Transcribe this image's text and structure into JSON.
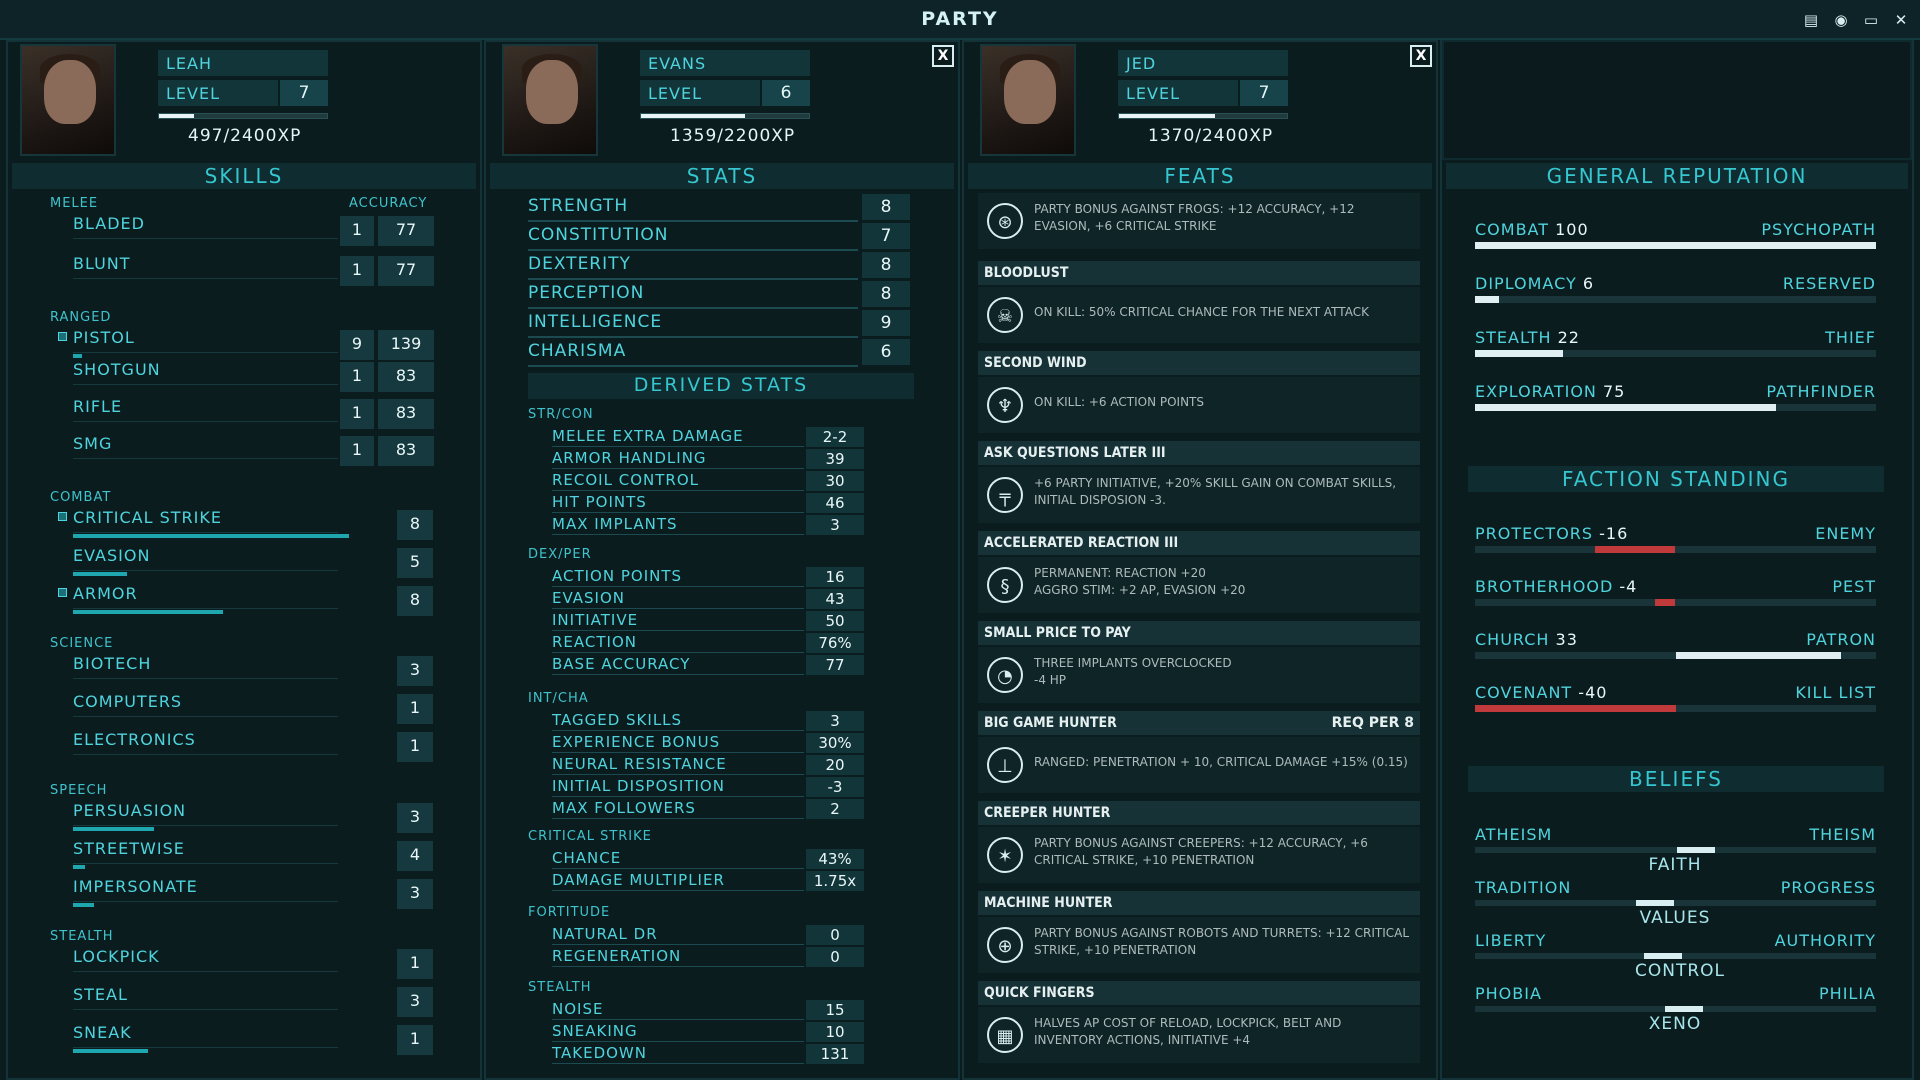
{
  "title": "PARTY",
  "window_controls": [
    "save-icon",
    "brain-icon",
    "monitor-icon",
    "close-icon"
  ],
  "characters": [
    {
      "name": "LEAH",
      "level_label": "LEVEL",
      "level": "7",
      "xp": "497/2400XP",
      "xp_fraction": 0.21,
      "closable": false
    },
    {
      "name": "EVANS",
      "level_label": "LEVEL",
      "level": "6",
      "xp": "1359/2200XP",
      "xp_fraction": 0.62,
      "closable": true,
      "close_label": "X"
    },
    {
      "name": "JED",
      "level_label": "LEVEL",
      "level": "7",
      "xp": "1370/2400XP",
      "xp_fraction": 0.57,
      "closable": true,
      "close_label": "X"
    }
  ],
  "skills": {
    "title": "SKILLS",
    "accuracy_label": "ACCURACY",
    "groups": [
      {
        "name": "MELEE",
        "items": [
          {
            "name": "BLADED",
            "level": "1",
            "accuracy": "77"
          },
          {
            "name": "BLUNT",
            "level": "1",
            "accuracy": "77"
          }
        ]
      },
      {
        "name": "RANGED",
        "items": [
          {
            "name": "PISTOL",
            "level": "9",
            "accuracy": "139",
            "tagged": true,
            "progress": 0.03
          },
          {
            "name": "SHOTGUN",
            "level": "1",
            "accuracy": "83"
          },
          {
            "name": "RIFLE",
            "level": "1",
            "accuracy": "83"
          },
          {
            "name": "SMG",
            "level": "1",
            "accuracy": "83"
          }
        ]
      },
      {
        "name": "COMBAT",
        "items": [
          {
            "name": "CRITICAL STRIKE",
            "level": "8",
            "tagged": true,
            "progress": 0.92
          },
          {
            "name": "EVASION",
            "level": "5",
            "progress": 0.18
          },
          {
            "name": "ARMOR",
            "level": "8",
            "tagged": true,
            "progress": 0.5
          }
        ]
      },
      {
        "name": "SCIENCE",
        "items": [
          {
            "name": "BIOTECH",
            "level": "3"
          },
          {
            "name": "COMPUTERS",
            "level": "1"
          },
          {
            "name": "ELECTRONICS",
            "level": "1"
          }
        ]
      },
      {
        "name": "SPEECH",
        "items": [
          {
            "name": "PERSUASION",
            "level": "3",
            "progress": 0.27
          },
          {
            "name": "STREETWISE",
            "level": "4",
            "progress": 0.04
          },
          {
            "name": "IMPERSONATE",
            "level": "3",
            "progress": 0.07
          }
        ]
      },
      {
        "name": "STEALTH",
        "items": [
          {
            "name": "LOCKPICK",
            "level": "1"
          },
          {
            "name": "STEAL",
            "level": "3"
          },
          {
            "name": "SNEAK",
            "level": "1",
            "progress": 0.25
          }
        ]
      }
    ]
  },
  "stats": {
    "title": "STATS",
    "items": [
      {
        "name": "STRENGTH",
        "value": "8"
      },
      {
        "name": "CONSTITUTION",
        "value": "7"
      },
      {
        "name": "DEXTERITY",
        "value": "8"
      },
      {
        "name": "PERCEPTION",
        "value": "8"
      },
      {
        "name": "INTELLIGENCE",
        "value": "9"
      },
      {
        "name": "CHARISMA",
        "value": "6"
      }
    ],
    "derived_title": "DERIVED STATS",
    "derived": [
      {
        "group": "STR/CON",
        "items": [
          {
            "name": "MELEE EXTRA DAMAGE",
            "value": "2-2"
          },
          {
            "name": "ARMOR HANDLING",
            "value": "39"
          },
          {
            "name": "RECOIL CONTROL",
            "value": "30"
          },
          {
            "name": "HIT POINTS",
            "value": "46"
          },
          {
            "name": "MAX IMPLANTS",
            "value": "3"
          }
        ]
      },
      {
        "group": "DEX/PER",
        "items": [
          {
            "name": "ACTION POINTS",
            "value": "16"
          },
          {
            "name": "EVASION",
            "value": "43"
          },
          {
            "name": "INITIATIVE",
            "value": "50"
          },
          {
            "name": "REACTION",
            "value": "76%"
          },
          {
            "name": "BASE ACCURACY",
            "value": "77"
          }
        ]
      },
      {
        "group": "INT/CHA",
        "items": [
          {
            "name": "TAGGED SKILLS",
            "value": "3"
          },
          {
            "name": "EXPERIENCE BONUS",
            "value": "30%"
          },
          {
            "name": "NEURAL RESISTANCE",
            "value": "20"
          },
          {
            "name": "INITIAL DISPOSITION",
            "value": "-3"
          },
          {
            "name": "MAX FOLLOWERS",
            "value": "2"
          }
        ]
      },
      {
        "group": "CRITICAL STRIKE",
        "items": [
          {
            "name": "CHANCE",
            "value": "43%"
          },
          {
            "name": "DAMAGE MULTIPLIER",
            "value": "1.75x"
          }
        ]
      },
      {
        "group": "FORTITUDE",
        "items": [
          {
            "name": "NATURAL DR",
            "value": "0"
          },
          {
            "name": "REGENERATION",
            "value": "0"
          }
        ]
      },
      {
        "group": "STEALTH",
        "items": [
          {
            "name": "NOISE",
            "value": "15"
          },
          {
            "name": "SNEAKING",
            "value": "10"
          },
          {
            "name": "TAKEDOWN",
            "value": "131"
          }
        ]
      }
    ]
  },
  "feats": {
    "title": "FEATS",
    "items": [
      {
        "name": "",
        "icon": "frog-target-icon",
        "desc": "PARTY BONUS AGAINST FROGS: +12 ACCURACY, +12 EVASION, +6 CRITICAL STRIKE",
        "req": ""
      },
      {
        "name": "BLOODLUST",
        "icon": "skull-icon",
        "desc": "ON KILL: 50% CRITICAL CHANCE FOR THE NEXT ATTACK",
        "req": ""
      },
      {
        "name": "SECOND WIND",
        "icon": "lungs-icon",
        "desc": "ON KILL: +6 ACTION POINTS",
        "req": ""
      },
      {
        "name": "ASK QUESTIONS LATER III",
        "icon": "pistol-icon",
        "desc": "+6 PARTY INITIATIVE, +20% SKILL GAIN ON COMBAT SKILLS, INITIAL DISPOSION -3.",
        "req": ""
      },
      {
        "name": "ACCELERATED REACTION III",
        "icon": "dna-icon",
        "desc": "PERMANENT: REACTION +20\nAGGRO STIM: +2 AP, EVASION +20",
        "req": ""
      },
      {
        "name": "SMALL PRICE TO PAY",
        "icon": "gauge-icon",
        "desc": "THREE IMPLANTS OVERCLOCKED\n-4 HP",
        "req": ""
      },
      {
        "name": "BIG GAME HUNTER",
        "icon": "rifle-icon",
        "desc": "RANGED: PENETRATION + 10, CRITICAL DAMAGE +15% (0.15)",
        "req": "REQ PER 8"
      },
      {
        "name": "CREEPER HUNTER",
        "icon": "creeper-target-icon",
        "desc": "PARTY BONUS AGAINST CREEPERS: +12 ACCURACY, +6 CRITICAL STRIKE, +10 PENETRATION",
        "req": ""
      },
      {
        "name": "MACHINE HUNTER",
        "icon": "robot-target-icon",
        "desc": "PARTY BONUS AGAINST ROBOTS AND TURRETS: +12 CRITICAL STRIKE, +10 PENETRATION",
        "req": ""
      },
      {
        "name": "QUICK FINGERS",
        "icon": "cards-icon",
        "desc": "HALVES AP COST OF RELOAD, LOCKPICK, BELT AND INVENTORY ACTIONS, INITIATIVE +4",
        "req": ""
      }
    ]
  },
  "reputation": {
    "title": "GENERAL REPUTATION",
    "items": [
      {
        "name": "COMBAT",
        "value": "100",
        "title": "PSYCHOPATH",
        "fraction": 1.0
      },
      {
        "name": "DIPLOMACY",
        "value": "6",
        "title": "RESERVED",
        "fraction": 0.06
      },
      {
        "name": "STEALTH",
        "value": "22",
        "title": "THIEF",
        "fraction": 0.22
      },
      {
        "name": "EXPLORATION",
        "value": "75",
        "title": "PATHFINDER",
        "fraction": 0.75
      }
    ]
  },
  "factions": {
    "title": "FACTION STANDING",
    "items": [
      {
        "name": "PROTECTORS",
        "value": "-16",
        "title": "ENEMY",
        "standing": -16
      },
      {
        "name": "BROTHERHOOD",
        "value": "-4",
        "title": "PEST",
        "standing": -4
      },
      {
        "name": "CHURCH",
        "value": "33",
        "title": "PATRON",
        "standing": 33
      },
      {
        "name": "COVENANT",
        "value": "-40",
        "title": "KILL LIST",
        "standing": -40
      }
    ]
  },
  "beliefs": {
    "title": "BELIEFS",
    "items": [
      {
        "left": "ATHEISM",
        "right": "THEISM",
        "center": "FAITH",
        "position": 0.55
      },
      {
        "left": "TRADITION",
        "right": "PROGRESS",
        "center": "VALUES",
        "position": 0.45
      },
      {
        "left": "LIBERTY",
        "right": "AUTHORITY",
        "center": "CONTROL",
        "position": 0.47
      },
      {
        "left": "PHOBIA",
        "right": "PHILIA",
        "center": "XENO",
        "position": 0.52
      }
    ]
  },
  "colors": {
    "accent": "#4fd4dd",
    "bar": "#1fa7b0",
    "enemy": "#c0393b",
    "friendly": "#d8eef0",
    "panel": "#12353a"
  }
}
